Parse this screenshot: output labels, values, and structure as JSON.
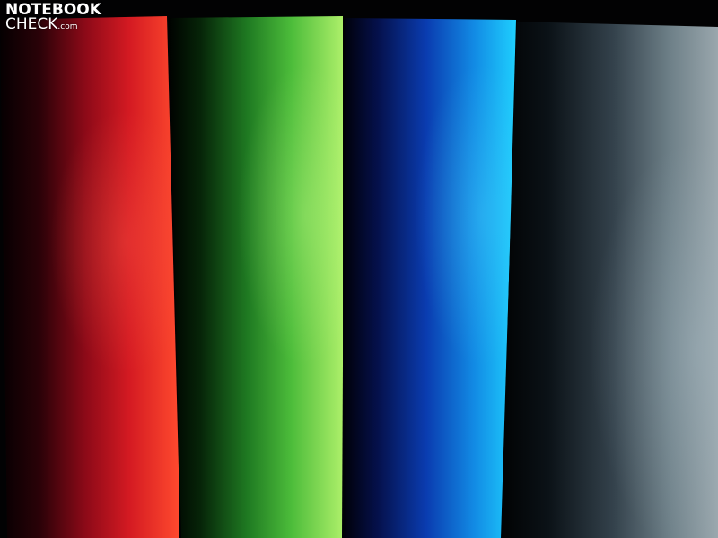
{
  "logo": {
    "line1": "NOTEBOOK",
    "line2": "CHECK",
    "suffix": ".com"
  },
  "colors": {
    "background": "#020203",
    "red_bar": "#ff4a2e",
    "green_bar": "#aef06a",
    "blue_bar": "#1fd2ff",
    "gray_bar": "#9aa7ad"
  }
}
